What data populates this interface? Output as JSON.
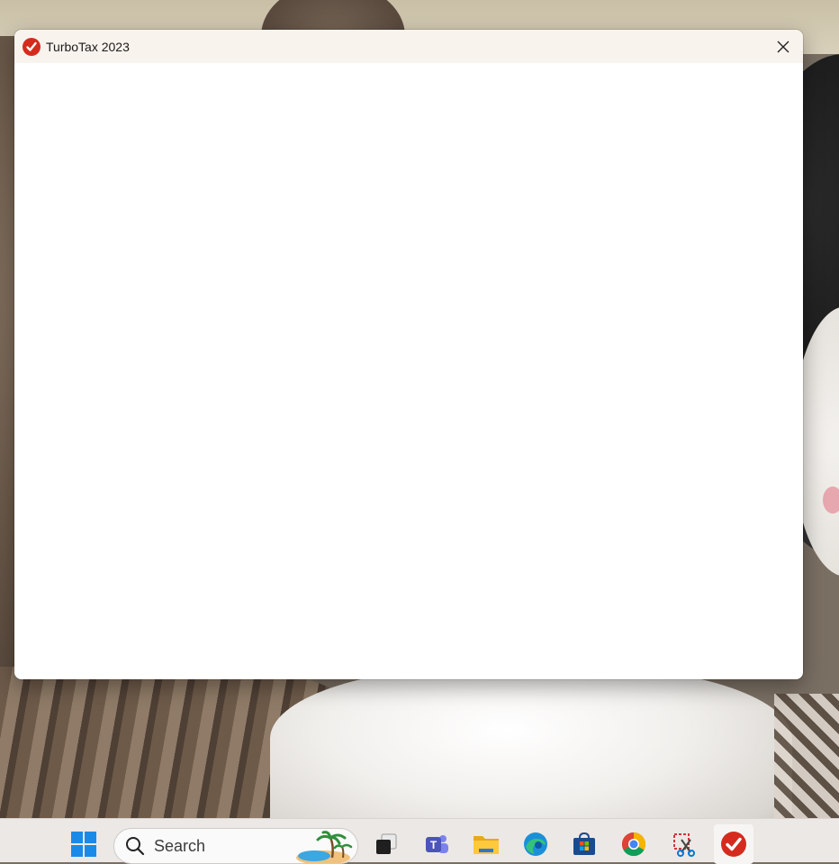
{
  "window": {
    "title": "TurboTax 2023",
    "app_icon": "turbotax-check-icon",
    "close_icon": "close-icon"
  },
  "taskbar": {
    "search": {
      "placeholder": "Search"
    },
    "items": [
      {
        "name": "start-menu",
        "icon": "windows-logo-icon"
      },
      {
        "name": "task-view",
        "icon": "task-view-icon"
      },
      {
        "name": "teams",
        "icon": "teams-icon"
      },
      {
        "name": "file-explorer",
        "icon": "folder-icon"
      },
      {
        "name": "edge",
        "icon": "edge-icon"
      },
      {
        "name": "microsoft-store",
        "icon": "store-icon"
      },
      {
        "name": "chrome",
        "icon": "chrome-icon"
      },
      {
        "name": "snipping-tool",
        "icon": "snipping-tool-icon"
      },
      {
        "name": "turbotax",
        "icon": "turbotax-check-icon"
      }
    ]
  },
  "colors": {
    "turbotax_red": "#d52b1e",
    "titlebar_bg": "#f9f3ee",
    "taskbar_bg": "#ece8e6"
  }
}
